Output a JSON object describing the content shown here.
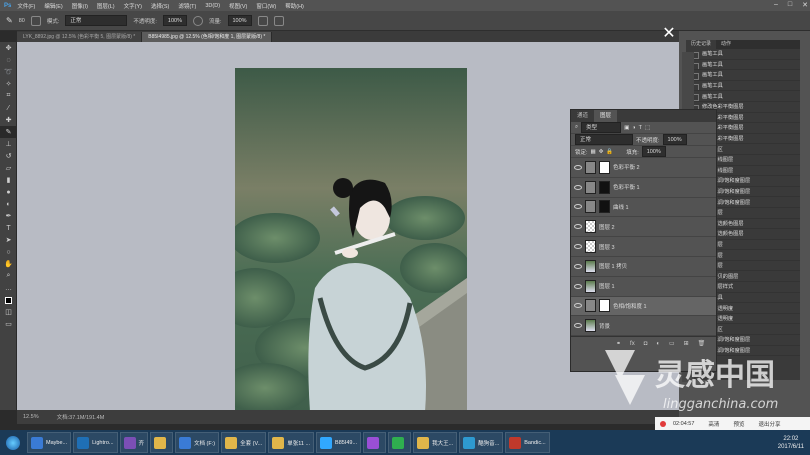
{
  "menu": {
    "app": "Ps",
    "items": [
      "文件(F)",
      "编辑(E)",
      "图像(I)",
      "图层(L)",
      "文字(Y)",
      "选择(S)",
      "滤镜(T)",
      "3D(D)",
      "视图(V)",
      "窗口(W)",
      "帮助(H)"
    ]
  },
  "options": {
    "brush_size": "80",
    "mode_label": "模式:",
    "mode_value": "正常",
    "opacity_label": "不透明度:",
    "opacity_value": "100%",
    "flow_label": "流量:",
    "flow_value": "100%"
  },
  "tabs": [
    {
      "label": "LYK_8892.jpg @ 12.5% (色彩平衡 5, 图层蒙版/8) *",
      "active": false
    },
    {
      "label": "B85I4985.jpg @ 12.5% (色相/饱和度 1, 图层蒙版/8) *",
      "active": true
    }
  ],
  "status": {
    "zoom": "12.5%",
    "doc": "文档:37.1M/191.4M"
  },
  "history": {
    "tabs": [
      "历史记录",
      "动作"
    ],
    "items": [
      "画笔工具",
      "画笔工具",
      "画笔工具",
      "画笔工具",
      "画笔工具",
      "修改色彩平衡图层",
      "新建色彩平衡图层",
      "修改色彩平衡图层",
      "修改色彩平衡图层",
      "载入选区",
      "新建曲线图层",
      "修改曲线图层",
      "新建色调/饱和度图层",
      "修改色调/饱和度图层",
      "新建色调/饱和度图层",
      "新建图层",
      "新建可选颜色图层",
      "修改可选颜色图层",
      "新建图层",
      "新建图层",
      "新建图层",
      "通过拷贝的图层",
      "添加图层样式",
      "画笔工具",
      "修改不透明度",
      "修改不透明度",
      "载入选区",
      "新建色调/饱和度图层",
      "修改色调/饱和度图层"
    ]
  },
  "layers": {
    "tabs": [
      "通道",
      "图层"
    ],
    "kind": "类型",
    "blend": "正常",
    "opacity_label": "不透明度:",
    "opacity": "100%",
    "lock_label": "锁定:",
    "fill_label": "填充:",
    "fill": "100%",
    "rows": [
      {
        "name": "色彩平衡 2",
        "thumb": "white"
      },
      {
        "name": "色彩平衡 1",
        "thumb": "dark"
      },
      {
        "name": "曲线 1",
        "thumb": "dark"
      },
      {
        "name": "图层 2",
        "thumb": "check"
      },
      {
        "name": "图层 3",
        "thumb": "check"
      },
      {
        "name": "图层 1 拷贝",
        "thumb": "img"
      },
      {
        "name": "图层 1",
        "thumb": "img"
      },
      {
        "name": "色相/饱和度 1",
        "thumb": "white"
      },
      {
        "name": "背景",
        "thumb": "img"
      }
    ],
    "footer": "fx"
  },
  "recorder": {
    "time": "02:04:57",
    "items": [
      "高清",
      "预览",
      "退出分享"
    ]
  },
  "taskbar": {
    "apps": [
      "Maybe...",
      "Lightro...",
      "齐",
      "",
      "文档 (F:)",
      "全套 (V...",
      "单张11 ...",
      "B85I49...",
      "",
      "",
      "我大王...",
      "酷狗音...",
      "Bandic..."
    ],
    "time": "22:02",
    "date": "2017/6/11"
  },
  "watermark": {
    "brand": "灵感中国",
    "url": "lingganchina.com"
  }
}
